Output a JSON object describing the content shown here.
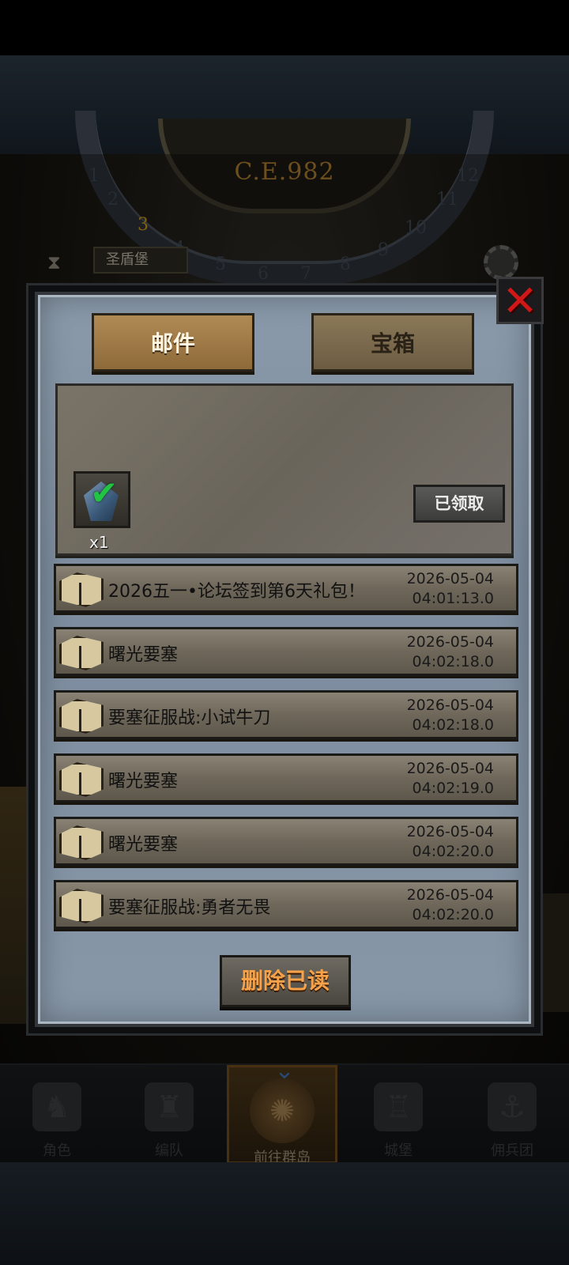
{
  "scene": {
    "year_label": "C.E.982",
    "dial_numbers": [
      "1",
      "2",
      "3",
      "4",
      "5",
      "6",
      "7",
      "8",
      "9",
      "10",
      "11",
      "12"
    ],
    "highlighted_dial_number": "3",
    "banner_label": "圣盾堡"
  },
  "dialog": {
    "close_icon": "close-icon",
    "tabs": [
      {
        "label": "邮件",
        "active": true
      },
      {
        "label": "宝箱",
        "active": false
      }
    ],
    "detail": {
      "reward_icon": "crystal-icon",
      "reward_claimed_mark": "checkmark-icon",
      "reward_quantity": "x1",
      "claimed_button_label": "已领取"
    },
    "mails": [
      {
        "title": "2026五一•论坛签到第6天礼包！",
        "date": "2026-05-04",
        "time": "04:01:13.0"
      },
      {
        "title": "曙光要塞",
        "date": "2026-05-04",
        "time": "04:02:18.0"
      },
      {
        "title": "要塞征服战:小试牛刀",
        "date": "2026-05-04",
        "time": "04:02:18.0"
      },
      {
        "title": "曙光要塞",
        "date": "2026-05-04",
        "time": "04:02:19.0"
      },
      {
        "title": "曙光要塞",
        "date": "2026-05-04",
        "time": "04:02:20.0"
      },
      {
        "title": "要塞征服战:勇者无畏",
        "date": "2026-05-04",
        "time": "04:02:20.0"
      }
    ],
    "delete_read_label": "删除已读"
  },
  "nav": {
    "items": [
      {
        "label": "角色",
        "icon": "knight-icon",
        "active": false
      },
      {
        "label": "编队",
        "icon": "helmet-icon",
        "active": false
      },
      {
        "label": "前往群岛",
        "icon": "map-icon",
        "active": true
      },
      {
        "label": "城堡",
        "icon": "castle-icon",
        "active": false
      },
      {
        "label": "佣兵团",
        "icon": "ship-icon",
        "active": false
      }
    ]
  },
  "colors": {
    "accent_orange": "#f6a24a",
    "close_red": "#d01818",
    "check_green": "#22c444",
    "year_gold": "#a8782e"
  }
}
